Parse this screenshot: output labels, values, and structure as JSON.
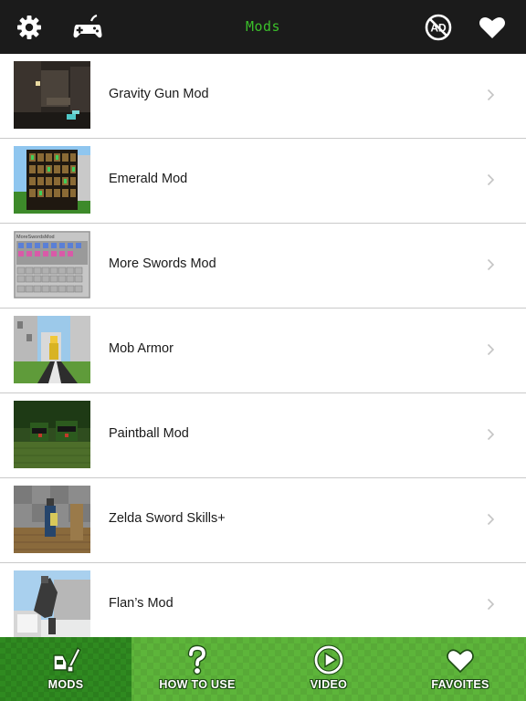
{
  "header": {
    "title": "Mods",
    "title_color": "#3bbf2a",
    "background": "#1b1b1b",
    "left_icons": [
      "gear-icon",
      "gamepad-icon"
    ],
    "right_icons": [
      "no-ads-icon",
      "heart-icon"
    ],
    "no_ads_text": "AD"
  },
  "list": {
    "items": [
      {
        "label": "Gravity Gun Mod",
        "thumb": "dark-cave"
      },
      {
        "label": "Emerald Mod",
        "thumb": "emerald-inventory"
      },
      {
        "label": "More Swords Mod",
        "thumb": "swords-inventory",
        "thumb_caption": "MoreSwordsMod"
      },
      {
        "label": "Mob Armor",
        "thumb": "city-road"
      },
      {
        "label": "Paintball Mod",
        "thumb": "paintball-field"
      },
      {
        "label": "Zelda Sword Skills+",
        "thumb": "zelda-room"
      },
      {
        "label": "Flan’s Mod",
        "thumb": "flans-soldier"
      }
    ]
  },
  "tabbar": {
    "active": 0,
    "tabs": [
      {
        "label": "MODS",
        "icon": "mods-icon"
      },
      {
        "label": "HOW TO USE",
        "icon": "question-icon"
      },
      {
        "label": "VIDEO",
        "icon": "play-icon"
      },
      {
        "label": "FAVOITES",
        "icon": "heart-icon"
      }
    ]
  }
}
